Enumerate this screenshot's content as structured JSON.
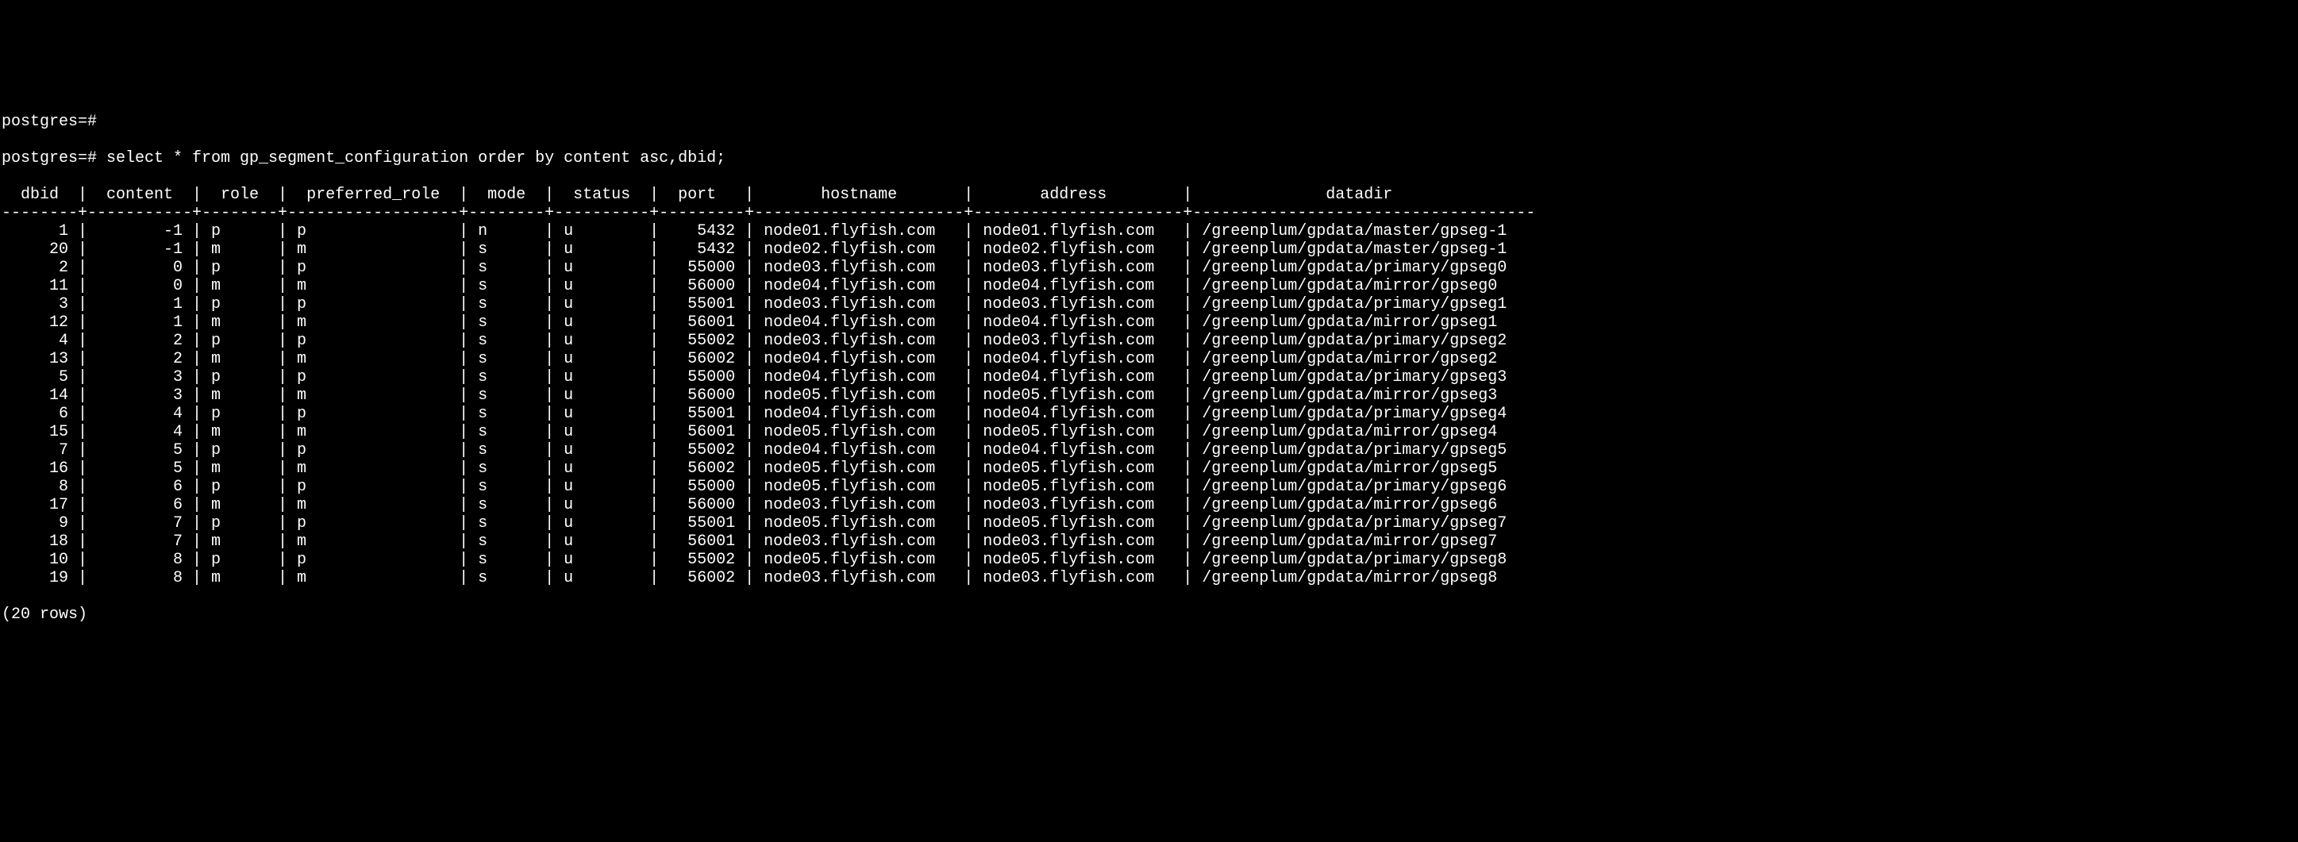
{
  "prompt_lines": [
    "postgres=#",
    "postgres=# select * from gp_segment_configuration order by content asc,dbid;"
  ],
  "columns": [
    "dbid",
    "content",
    "role",
    "preferred_role",
    "mode",
    "status",
    "port",
    "hostname",
    "address",
    "datadir"
  ],
  "rows": [
    {
      "dbid": 1,
      "content": -1,
      "role": "p",
      "preferred_role": "p",
      "mode": "n",
      "status": "u",
      "port": 5432,
      "hostname": "node01.flyfish.com",
      "address": "node01.flyfish.com",
      "datadir": "/greenplum/gpdata/master/gpseg-1"
    },
    {
      "dbid": 20,
      "content": -1,
      "role": "m",
      "preferred_role": "m",
      "mode": "s",
      "status": "u",
      "port": 5432,
      "hostname": "node02.flyfish.com",
      "address": "node02.flyfish.com",
      "datadir": "/greenplum/gpdata/master/gpseg-1"
    },
    {
      "dbid": 2,
      "content": 0,
      "role": "p",
      "preferred_role": "p",
      "mode": "s",
      "status": "u",
      "port": 55000,
      "hostname": "node03.flyfish.com",
      "address": "node03.flyfish.com",
      "datadir": "/greenplum/gpdata/primary/gpseg0"
    },
    {
      "dbid": 11,
      "content": 0,
      "role": "m",
      "preferred_role": "m",
      "mode": "s",
      "status": "u",
      "port": 56000,
      "hostname": "node04.flyfish.com",
      "address": "node04.flyfish.com",
      "datadir": "/greenplum/gpdata/mirror/gpseg0"
    },
    {
      "dbid": 3,
      "content": 1,
      "role": "p",
      "preferred_role": "p",
      "mode": "s",
      "status": "u",
      "port": 55001,
      "hostname": "node03.flyfish.com",
      "address": "node03.flyfish.com",
      "datadir": "/greenplum/gpdata/primary/gpseg1"
    },
    {
      "dbid": 12,
      "content": 1,
      "role": "m",
      "preferred_role": "m",
      "mode": "s",
      "status": "u",
      "port": 56001,
      "hostname": "node04.flyfish.com",
      "address": "node04.flyfish.com",
      "datadir": "/greenplum/gpdata/mirror/gpseg1"
    },
    {
      "dbid": 4,
      "content": 2,
      "role": "p",
      "preferred_role": "p",
      "mode": "s",
      "status": "u",
      "port": 55002,
      "hostname": "node03.flyfish.com",
      "address": "node03.flyfish.com",
      "datadir": "/greenplum/gpdata/primary/gpseg2"
    },
    {
      "dbid": 13,
      "content": 2,
      "role": "m",
      "preferred_role": "m",
      "mode": "s",
      "status": "u",
      "port": 56002,
      "hostname": "node04.flyfish.com",
      "address": "node04.flyfish.com",
      "datadir": "/greenplum/gpdata/mirror/gpseg2"
    },
    {
      "dbid": 5,
      "content": 3,
      "role": "p",
      "preferred_role": "p",
      "mode": "s",
      "status": "u",
      "port": 55000,
      "hostname": "node04.flyfish.com",
      "address": "node04.flyfish.com",
      "datadir": "/greenplum/gpdata/primary/gpseg3"
    },
    {
      "dbid": 14,
      "content": 3,
      "role": "m",
      "preferred_role": "m",
      "mode": "s",
      "status": "u",
      "port": 56000,
      "hostname": "node05.flyfish.com",
      "address": "node05.flyfish.com",
      "datadir": "/greenplum/gpdata/mirror/gpseg3"
    },
    {
      "dbid": 6,
      "content": 4,
      "role": "p",
      "preferred_role": "p",
      "mode": "s",
      "status": "u",
      "port": 55001,
      "hostname": "node04.flyfish.com",
      "address": "node04.flyfish.com",
      "datadir": "/greenplum/gpdata/primary/gpseg4"
    },
    {
      "dbid": 15,
      "content": 4,
      "role": "m",
      "preferred_role": "m",
      "mode": "s",
      "status": "u",
      "port": 56001,
      "hostname": "node05.flyfish.com",
      "address": "node05.flyfish.com",
      "datadir": "/greenplum/gpdata/mirror/gpseg4"
    },
    {
      "dbid": 7,
      "content": 5,
      "role": "p",
      "preferred_role": "p",
      "mode": "s",
      "status": "u",
      "port": 55002,
      "hostname": "node04.flyfish.com",
      "address": "node04.flyfish.com",
      "datadir": "/greenplum/gpdata/primary/gpseg5"
    },
    {
      "dbid": 16,
      "content": 5,
      "role": "m",
      "preferred_role": "m",
      "mode": "s",
      "status": "u",
      "port": 56002,
      "hostname": "node05.flyfish.com",
      "address": "node05.flyfish.com",
      "datadir": "/greenplum/gpdata/mirror/gpseg5"
    },
    {
      "dbid": 8,
      "content": 6,
      "role": "p",
      "preferred_role": "p",
      "mode": "s",
      "status": "u",
      "port": 55000,
      "hostname": "node05.flyfish.com",
      "address": "node05.flyfish.com",
      "datadir": "/greenplum/gpdata/primary/gpseg6"
    },
    {
      "dbid": 17,
      "content": 6,
      "role": "m",
      "preferred_role": "m",
      "mode": "s",
      "status": "u",
      "port": 56000,
      "hostname": "node03.flyfish.com",
      "address": "node03.flyfish.com",
      "datadir": "/greenplum/gpdata/mirror/gpseg6"
    },
    {
      "dbid": 9,
      "content": 7,
      "role": "p",
      "preferred_role": "p",
      "mode": "s",
      "status": "u",
      "port": 55001,
      "hostname": "node05.flyfish.com",
      "address": "node05.flyfish.com",
      "datadir": "/greenplum/gpdata/primary/gpseg7"
    },
    {
      "dbid": 18,
      "content": 7,
      "role": "m",
      "preferred_role": "m",
      "mode": "s",
      "status": "u",
      "port": 56001,
      "hostname": "node03.flyfish.com",
      "address": "node03.flyfish.com",
      "datadir": "/greenplum/gpdata/mirror/gpseg7"
    },
    {
      "dbid": 10,
      "content": 8,
      "role": "p",
      "preferred_role": "p",
      "mode": "s",
      "status": "u",
      "port": 55002,
      "hostname": "node05.flyfish.com",
      "address": "node05.flyfish.com",
      "datadir": "/greenplum/gpdata/primary/gpseg8"
    },
    {
      "dbid": 19,
      "content": 8,
      "role": "m",
      "preferred_role": "m",
      "mode": "s",
      "status": "u",
      "port": 56002,
      "hostname": "node03.flyfish.com",
      "address": "node03.flyfish.com",
      "datadir": "/greenplum/gpdata/mirror/gpseg8"
    }
  ],
  "row_count_label": "(20 rows)"
}
